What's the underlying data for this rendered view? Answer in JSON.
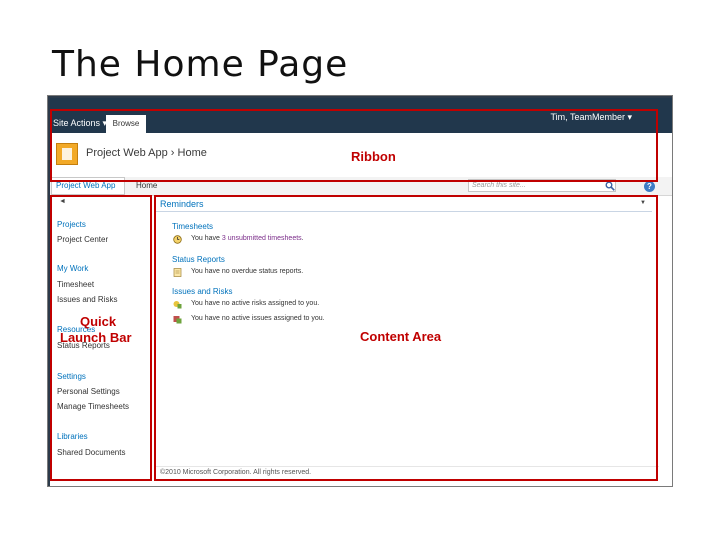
{
  "slide": {
    "title": "The Home Page"
  },
  "topbar": {
    "site_actions": "Site Actions ▾",
    "browse_tab": "Browse",
    "user_menu": "Tim, TeamMember ▾"
  },
  "ribbon": {
    "page_path": "Project Web App › Home",
    "callout": "Ribbon"
  },
  "topnav": {
    "tabs": [
      {
        "label": "Project Web App"
      },
      {
        "label": "Home"
      }
    ],
    "search_placeholder": "Search this site...",
    "help_glyph": "?"
  },
  "quick_launch": {
    "collapse_glyph": "◄",
    "callout_line1": "Quick",
    "callout_line2": "Launch Bar",
    "sections": [
      {
        "heading": "Projects",
        "links": [
          "Project Center"
        ]
      },
      {
        "heading": "My Work",
        "links": [
          "Timesheet",
          "Issues and Risks"
        ]
      },
      {
        "heading": "Resources",
        "links": [
          "Status Reports"
        ]
      },
      {
        "heading": "Settings",
        "links": [
          "Personal Settings",
          "Manage Timesheets"
        ]
      },
      {
        "heading": "Libraries",
        "links": [
          "Shared Documents"
        ]
      }
    ]
  },
  "content": {
    "web_part_title": "Reminders",
    "web_part_menu_glyph": "▼",
    "callout": "Content Area",
    "sections": [
      {
        "heading": "Timesheets",
        "items": [
          {
            "prefix": "You have ",
            "link": "3 unsubmitted timesheets",
            "suffix": "."
          }
        ]
      },
      {
        "heading": "Status Reports",
        "items": [
          {
            "prefix": "",
            "link": "",
            "suffix": "You have no overdue status reports."
          }
        ]
      },
      {
        "heading": "Issues and Risks",
        "items": [
          {
            "prefix": "",
            "link": "",
            "suffix": "You have no active risks assigned to you."
          },
          {
            "prefix": "",
            "link": "",
            "suffix": "You have no active issues assigned to you."
          }
        ]
      }
    ],
    "footer": "©2010 Microsoft Corporation. All rights reserved."
  },
  "colors": {
    "topbar": "#21374c",
    "callout_red": "#c00000",
    "link_blue": "#0072bc"
  }
}
